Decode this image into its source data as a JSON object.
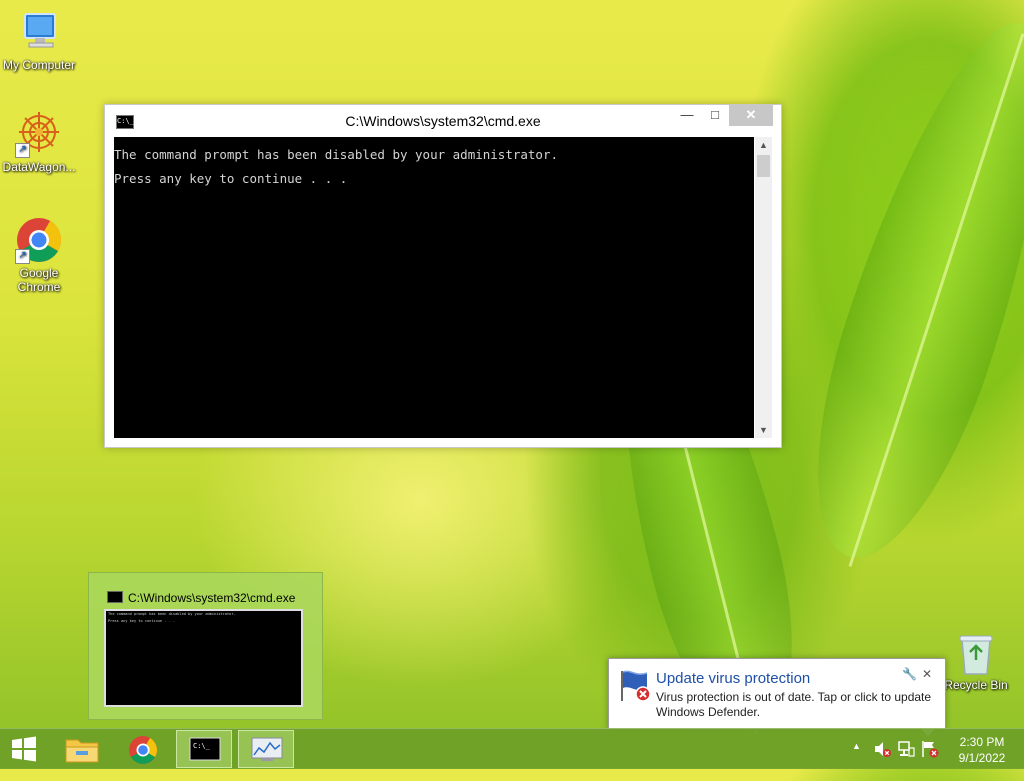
{
  "desktop": {
    "icons": [
      {
        "label": "My Computer"
      },
      {
        "label": "DataWagon..."
      },
      {
        "label": "Google Chrome"
      }
    ],
    "recycle_bin": {
      "label": "Recycle Bin"
    }
  },
  "cmd_window": {
    "title": "C:\\Windows\\system32\\cmd.exe",
    "icon_text": "C:\\_",
    "buttons": {
      "minimize": "—",
      "maximize": "□",
      "close": "✕"
    },
    "lines": [
      "The command prompt has been disabled by your administrator.",
      "Press any key to continue . . ."
    ]
  },
  "taskbar_preview": {
    "title": "C:\\Windows\\system32\\cmd.exe",
    "lines": [
      "The command prompt has been disabled by your administrator.",
      "Press any key to continue . . ."
    ]
  },
  "notification": {
    "title": "Update virus protection",
    "message": "Virus protection is out of date. Tap or click to update Windows Defender.",
    "settings_glyph": "🔧",
    "close_glyph": "✕"
  },
  "taskbar": {
    "items": [
      {
        "name": "start-button",
        "icon": "windows-logo-icon"
      },
      {
        "name": "file-explorer",
        "icon": "folder-icon"
      },
      {
        "name": "google-chrome",
        "icon": "chrome-icon"
      },
      {
        "name": "command-prompt",
        "icon": "cmd-icon",
        "active": true
      },
      {
        "name": "performance-monitor",
        "icon": "monitor-chart-icon"
      }
    ],
    "tray": {
      "arrow": "▲",
      "clock_time": "2:30 PM",
      "clock_date": "9/1/2022"
    }
  },
  "colors": {
    "accent": "#1f4fa6",
    "taskbar": "#6ea028",
    "console_bg": "#000000",
    "error_red": "#d32f2f"
  }
}
